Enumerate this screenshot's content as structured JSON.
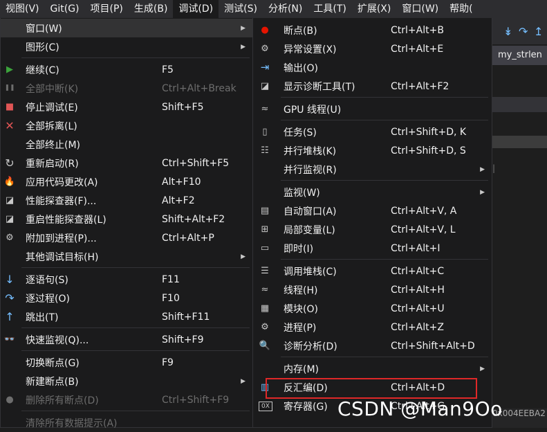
{
  "menubar": [
    {
      "label": "视图(V)"
    },
    {
      "label": "Git(G)"
    },
    {
      "label": "项目(P)"
    },
    {
      "label": "生成(B)"
    },
    {
      "label": "调试(D)"
    },
    {
      "label": "测试(S)"
    },
    {
      "label": "分析(N)"
    },
    {
      "label": "工具(T)"
    },
    {
      "label": "扩展(X)"
    },
    {
      "label": "窗口(W)"
    },
    {
      "label": "帮助("
    }
  ],
  "background": {
    "tab_title": "my_strlen",
    "toolbar_icons": [
      "↡",
      "↷",
      "↥"
    ],
    "pipe": "|",
    "bottom_text": "0x004EEBA2"
  },
  "debug_menu": [
    {
      "label": "窗口(W)",
      "shortcut": "",
      "icon": "",
      "submenu": true
    },
    {
      "label": "图形(C)",
      "shortcut": "",
      "icon": "",
      "submenu": true
    },
    {
      "label": "继续(C)",
      "shortcut": "F5",
      "icon": "▶"
    },
    {
      "label": "全部中断(K)",
      "shortcut": "Ctrl+Alt+Break",
      "icon": "❚❚",
      "disabled": true
    },
    {
      "label": "停止调试(E)",
      "shortcut": "Shift+F5",
      "icon": "■"
    },
    {
      "label": "全部拆离(L)",
      "shortcut": "",
      "icon": "✕"
    },
    {
      "label": "全部终止(M)",
      "shortcut": "",
      "icon": ""
    },
    {
      "label": "重新启动(R)",
      "shortcut": "Ctrl+Shift+F5",
      "icon": "↻"
    },
    {
      "label": "应用代码更改(A)",
      "shortcut": "Alt+F10",
      "icon": "🔥"
    },
    {
      "label": "性能探查器(F)...",
      "shortcut": "Alt+F2",
      "icon": "◪"
    },
    {
      "label": "重启性能探查器(L)",
      "shortcut": "Shift+Alt+F2",
      "icon": "◪"
    },
    {
      "label": "附加到进程(P)...",
      "shortcut": "Ctrl+Alt+P",
      "icon": "⚙"
    },
    {
      "label": "其他调试目标(H)",
      "shortcut": "",
      "icon": "",
      "submenu": true
    },
    {
      "label": "逐语句(S)",
      "shortcut": "F11",
      "icon": "↓"
    },
    {
      "label": "逐过程(O)",
      "shortcut": "F10",
      "icon": "↷"
    },
    {
      "label": "跳出(T)",
      "shortcut": "Shift+F11",
      "icon": "↑"
    },
    {
      "label": "快速监视(Q)...",
      "shortcut": "Shift+F9",
      "icon": "👓"
    },
    {
      "label": "切换断点(G)",
      "shortcut": "F9",
      "icon": ""
    },
    {
      "label": "新建断点(B)",
      "shortcut": "",
      "icon": "",
      "submenu": true
    },
    {
      "label": "删除所有断点(D)",
      "shortcut": "Ctrl+Shift+F9",
      "icon": "●",
      "disabled": true
    },
    {
      "label": "清除所有数据提示(A)",
      "shortcut": "",
      "icon": "",
      "disabled": true
    }
  ],
  "window_submenu": [
    {
      "label": "断点(B)",
      "shortcut": "Ctrl+Alt+B",
      "icon": "●"
    },
    {
      "label": "异常设置(X)",
      "shortcut": "Ctrl+Alt+E",
      "icon": "⚙"
    },
    {
      "label": "输出(O)",
      "shortcut": "",
      "icon": "⇥"
    },
    {
      "label": "显示诊断工具(T)",
      "shortcut": "Ctrl+Alt+F2",
      "icon": "◪"
    },
    {
      "label": "GPU 线程(U)",
      "shortcut": "",
      "icon": "≈"
    },
    {
      "label": "任务(S)",
      "shortcut": "Ctrl+Shift+D, K",
      "icon": "▯"
    },
    {
      "label": "并行堆栈(K)",
      "shortcut": "Ctrl+Shift+D, S",
      "icon": "☷"
    },
    {
      "label": "并行监视(R)",
      "shortcut": "",
      "icon": "",
      "submenu": true
    },
    {
      "label": "监视(W)",
      "shortcut": "",
      "icon": "",
      "submenu": true
    },
    {
      "label": "自动窗口(A)",
      "shortcut": "Ctrl+Alt+V, A",
      "icon": "▤"
    },
    {
      "label": "局部变量(L)",
      "shortcut": "Ctrl+Alt+V, L",
      "icon": "⊞"
    },
    {
      "label": "即时(I)",
      "shortcut": "Ctrl+Alt+I",
      "icon": "▭"
    },
    {
      "label": "调用堆栈(C)",
      "shortcut": "Ctrl+Alt+C",
      "icon": "☰"
    },
    {
      "label": "线程(H)",
      "shortcut": "Ctrl+Alt+H",
      "icon": "≈"
    },
    {
      "label": "模块(O)",
      "shortcut": "Ctrl+Alt+U",
      "icon": "▦"
    },
    {
      "label": "进程(P)",
      "shortcut": "Ctrl+Alt+Z",
      "icon": "⚙"
    },
    {
      "label": "诊断分析(D)",
      "shortcut": "Ctrl+Shift+Alt+D",
      "icon": "🔍"
    },
    {
      "label": "内存(M)",
      "shortcut": "",
      "icon": "",
      "submenu": true
    },
    {
      "label": "反汇编(D)",
      "shortcut": "Ctrl+Alt+D",
      "icon": "▥",
      "highlight": true
    },
    {
      "label": "寄存器(G)",
      "shortcut": "Ctrl+Alt+G",
      "icon": "0X"
    }
  ],
  "watermark": "CSDN @Man9Oo",
  "colors": {
    "menu_bg": "#1b1b1c",
    "menubar_bg": "#2d2d30",
    "accent_red": "#e02828",
    "play_green": "#3ca33c",
    "stop_red": "#e05555"
  }
}
